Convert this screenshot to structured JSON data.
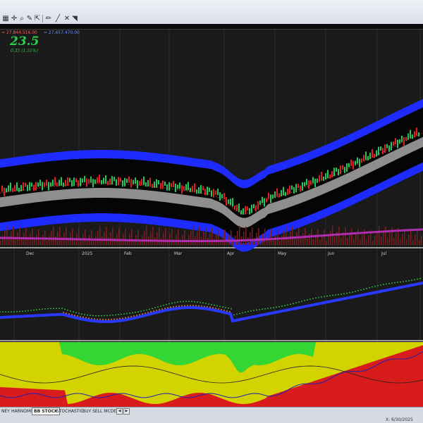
{
  "toolbar": {
    "icons": [
      "layout-icon",
      "crosshair-icon",
      "zoom-icon",
      "tools-icon",
      "draw-icon",
      "pencil-icon",
      "line-icon",
      "erase-icon"
    ]
  },
  "readouts": {
    "red_value": "= 27,844,516.00",
    "blue_value": "= 27,657,470.00"
  },
  "indicator": {
    "value": "23.5",
    "change": "0.35 (1.51%)"
  },
  "axis": {
    "months": [
      "Dec",
      "2025",
      "Feb",
      "Mar",
      "Apr",
      "May",
      "Jun",
      "Jul"
    ]
  },
  "tabs": [
    "NEY",
    "HARNOMIC",
    "BB STOCK",
    "STOCHASTIC",
    "BUY SELL MCDE"
  ],
  "active_tab": "BB STOCK",
  "status": {
    "date_label": "X: 6/30/2025"
  },
  "colors": {
    "band_blue": "#1e2bff",
    "price_up": "#22c95a",
    "price_down": "#e02020",
    "osc_yellow": "#e6e600",
    "osc_green": "#33d633",
    "osc_red": "#d81b1b"
  }
}
